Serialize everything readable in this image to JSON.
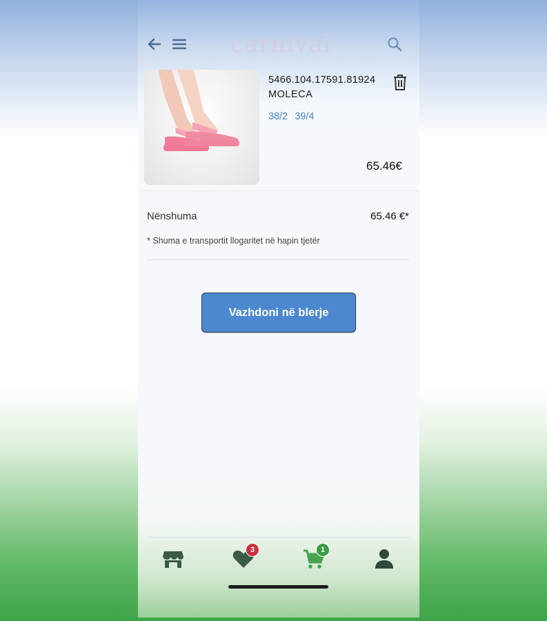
{
  "header": {
    "logo_text": "carnival",
    "back_icon": "arrow-left-icon",
    "menu_icon": "hamburger-menu-icon",
    "search_icon": "search-icon"
  },
  "cart_item": {
    "code": "5466.104.17591.81924",
    "name": "MOLECA",
    "sizes": [
      "38/2",
      "39/4"
    ],
    "price": "65.46€",
    "image": "pink platform slide sandals on feet",
    "delete_icon": "trash-icon"
  },
  "summary": {
    "subtotal_label": "Nënshuma",
    "subtotal_value": "65.46 €*",
    "shipping_note": "* Shuma e transportit llogaritet në hapin tjetër"
  },
  "checkout_button": "Vazhdoni në blerje",
  "tabbar": {
    "store_icon": "store-icon",
    "favorites_icon": "heart-icon",
    "favorites_count": "3",
    "cart_icon": "cart-icon",
    "cart_count": "1",
    "profile_icon": "user-icon"
  },
  "colors": {
    "accent": "#4c88cf",
    "size_link": "#4f86c6",
    "fav_badge": "#cc2f3a",
    "cart_badge": "#3d9a46",
    "cart_icon": "#46a34f"
  }
}
